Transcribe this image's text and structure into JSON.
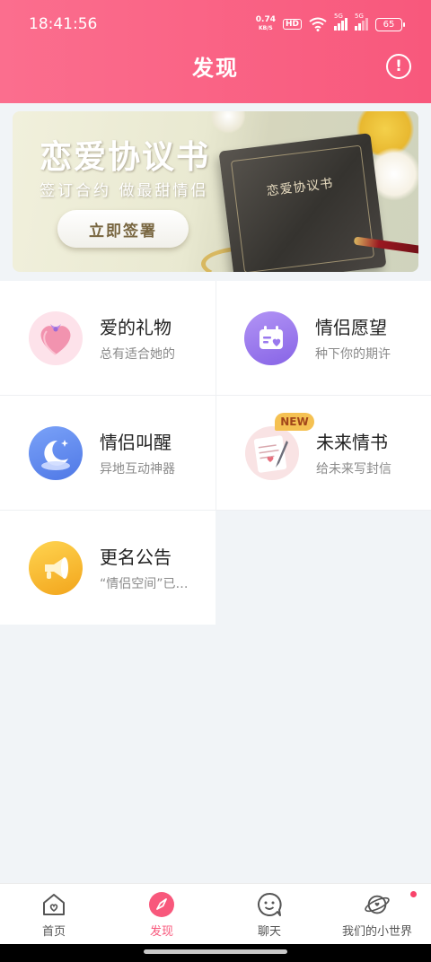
{
  "status_bar": {
    "time": "18:41:56",
    "net_speed_value": "0.74",
    "net_speed_unit": "KB/S",
    "hd_badge": "HD",
    "signal_tag_1": "5G",
    "signal_tag_2": "5G",
    "battery": "65"
  },
  "header": {
    "title": "发现",
    "info_icon": "info-icon"
  },
  "banner": {
    "title": "恋爱协议书",
    "subtitle": "签订合约 做最甜情侣",
    "button_label": "立即签署",
    "book_title": "恋爱协议书"
  },
  "features": [
    {
      "title": "爱的礼物",
      "subtitle": "总有适合她的",
      "icon": "gift-heart-icon",
      "color": "#f29ab2"
    },
    {
      "title": "情侣愿望",
      "subtitle": "种下你的期许",
      "icon": "calendar-heart-icon",
      "color": "#9b78ef"
    },
    {
      "title": "情侣叫醒",
      "subtitle": "异地互动神器",
      "icon": "moon-star-icon",
      "color": "#5a86ee"
    },
    {
      "title": "未来情书",
      "subtitle": "给未来写封信",
      "icon": "love-letter-icon",
      "color": "#f2b8be",
      "badge": "NEW"
    },
    {
      "title": "更名公告",
      "subtitle": "“情侣空间”已…",
      "icon": "megaphone-icon",
      "color": "#f5b82c"
    }
  ],
  "bottom_nav": [
    {
      "label": "首页",
      "icon": "home-heart-icon",
      "active": false
    },
    {
      "label": "发现",
      "icon": "compass-icon",
      "active": true
    },
    {
      "label": "聊天",
      "icon": "chat-smile-icon",
      "active": false
    },
    {
      "label": "我们的小世界",
      "icon": "planet-icon",
      "active": false,
      "dot": true
    }
  ],
  "colors": {
    "brand": "#f8587c",
    "background": "#f1f4f7",
    "new_badge": "#f5c152"
  }
}
